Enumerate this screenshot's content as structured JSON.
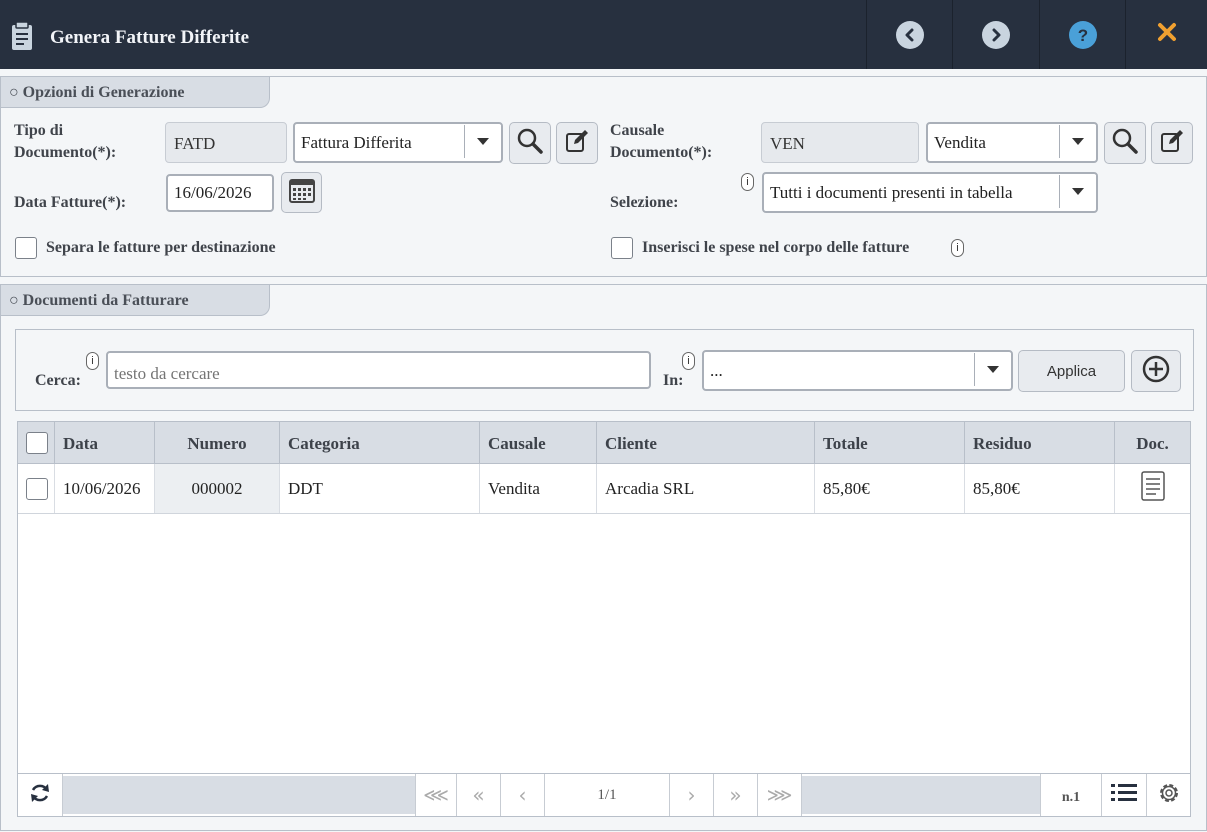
{
  "window": {
    "title": "Genera Fatture Differite",
    "buttons": [
      "back",
      "forward",
      "help",
      "close"
    ]
  },
  "options_panel": {
    "tab_label": "○ Opzioni di Generazione",
    "tipo_documento": {
      "label_line1": "Tipo di",
      "label_line2": "Documento(*):",
      "code": "FATD",
      "selected": "Fattura Differita"
    },
    "causale_documento": {
      "label_line1": "Causale",
      "label_line2": "Documento(*):",
      "code": "VEN",
      "selected": "Vendita"
    },
    "data_fatture": {
      "label": "Data Fatture(*):",
      "value": "16/06/2026"
    },
    "selezione": {
      "label": "Selezione:",
      "info": "i",
      "selected": "Tutti i documenti presenti in tabella"
    },
    "separa_checkbox": {
      "label": "Separa le fatture per destinazione",
      "checked": false
    },
    "spese_checkbox": {
      "label": "Inserisci le spese nel corpo delle fatture",
      "info": "i",
      "checked": false
    }
  },
  "documents_panel": {
    "tab_label": "○ Documenti da Fatturare",
    "search": {
      "label": "Cerca:",
      "info": "i",
      "placeholder": "testo da cercare",
      "in_label": "In:",
      "in_info": "i",
      "in_selected": "...",
      "apply_label": "Applica"
    },
    "table": {
      "columns": [
        "Data",
        "Numero",
        "Categoria",
        "Causale",
        "Cliente",
        "Totale",
        "Residuo",
        "Doc."
      ],
      "rows": [
        {
          "data": "10/06/2026",
          "numero": "000002",
          "categoria": "DDT",
          "causale": "Vendita",
          "cliente": "Arcadia SRL",
          "totale": "85,80€",
          "residuo": "85,80€"
        }
      ]
    },
    "pagination": {
      "page": "1/1",
      "count": "n.1"
    }
  },
  "colors": {
    "titlebar": "#27303f",
    "panel_header": "#d8dde4",
    "accent_close": "#f0a030"
  }
}
